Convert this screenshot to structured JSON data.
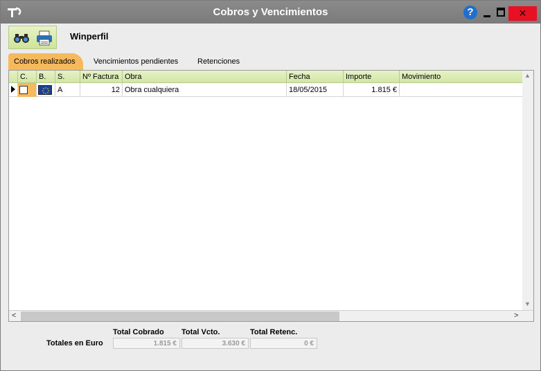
{
  "window": {
    "title": "Cobros y Vencimientos",
    "help_label": "?",
    "close_label": "✕"
  },
  "toolbar": {
    "company_name": "Winperfil"
  },
  "tabs": [
    {
      "label": "Cobros realizados"
    },
    {
      "label": "Vencimientos pendientes"
    },
    {
      "label": "Retenciones"
    }
  ],
  "table": {
    "columns": [
      "C.",
      "B.",
      "S.",
      "Nº Factura",
      "Obra",
      "Fecha",
      "Importe",
      "Movimiento"
    ],
    "rows": [
      {
        "serie": "A",
        "factura": "12",
        "obra": "Obra cualquiera",
        "fecha": "18/05/2015",
        "importe": "1.815 €",
        "movimiento": ""
      }
    ]
  },
  "totals": {
    "row_label": "Totales en Euro",
    "cobrado_label": "Total Cobrado",
    "vcto_label": "Total Vcto.",
    "retenc_label": "Total Retenc.",
    "cobrado": "1.815 €",
    "vcto": "3.630 €",
    "retenc": "0 €"
  },
  "colors": {
    "tab_active": "#f7b95e",
    "header_green": "#d3e6a5",
    "close_red": "#e81123"
  }
}
